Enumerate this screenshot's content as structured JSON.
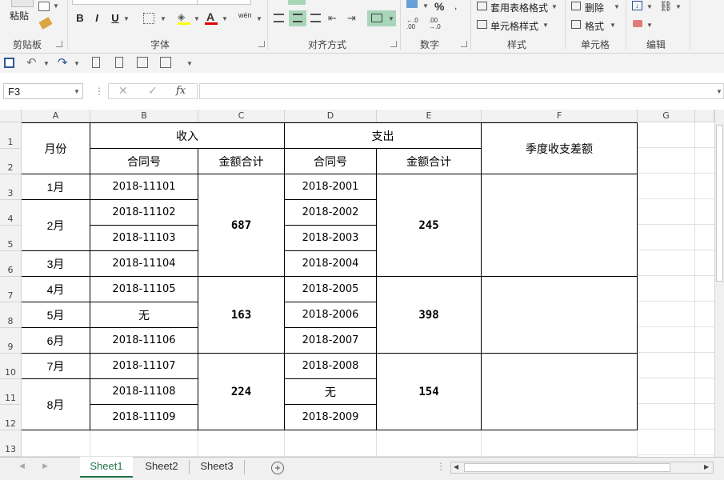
{
  "ribbon": {
    "clipboard": {
      "paste_label": "粘贴",
      "group_label": "剪贴板"
    },
    "font": {
      "group_label": "字体",
      "bold": "B",
      "italic": "I",
      "underline": "U",
      "phonetic": "wén"
    },
    "alignment": {
      "group_label": "对齐方式"
    },
    "number": {
      "group_label": "数字",
      "percent": "%"
    },
    "styles": {
      "group_label": "样式",
      "format_as_table": "套用表格格式",
      "cell_styles": "单元格样式"
    },
    "cells": {
      "group_label": "单元格",
      "delete": "删除",
      "format": "格式"
    },
    "editing": {
      "group_label": "编辑"
    }
  },
  "formula_bar": {
    "name_box": "F3",
    "fx": "fx",
    "formula": ""
  },
  "columns": [
    "A",
    "B",
    "C",
    "D",
    "E",
    "F",
    "G"
  ],
  "rows": [
    "1",
    "2",
    "3",
    "4",
    "5",
    "6",
    "7",
    "8",
    "9",
    "10",
    "11",
    "12",
    "13"
  ],
  "table": {
    "month_header": "月份",
    "income_header": "收入",
    "expense_header": "支出",
    "contract_header": "合同号",
    "amount_header": "金额合计",
    "diff_header": "季度收支差额",
    "months": [
      "1月",
      "2月",
      "3月",
      "4月",
      "5月",
      "6月",
      "7月",
      "8月"
    ],
    "income_contracts": [
      "2018-11101",
      "2018-11102",
      "2018-11103",
      "2018-11104",
      "2018-11105",
      "无",
      "2018-11106",
      "2018-11107",
      "2018-11108",
      "2018-11109"
    ],
    "expense_contracts": [
      "2018-2001",
      "2018-2002",
      "2018-2003",
      "2018-2004",
      "2018-2005",
      "2018-2006",
      "2018-2007",
      "2018-2008",
      "无",
      "2018-2009"
    ],
    "income_totals": [
      "687",
      "163",
      "224"
    ],
    "expense_totals": [
      "245",
      "398",
      "154"
    ]
  },
  "sheets": [
    "Sheet1",
    "Sheet2",
    "Sheet3"
  ],
  "colors": {
    "accent": "#217346",
    "selected_button": "#a9d5b9"
  }
}
